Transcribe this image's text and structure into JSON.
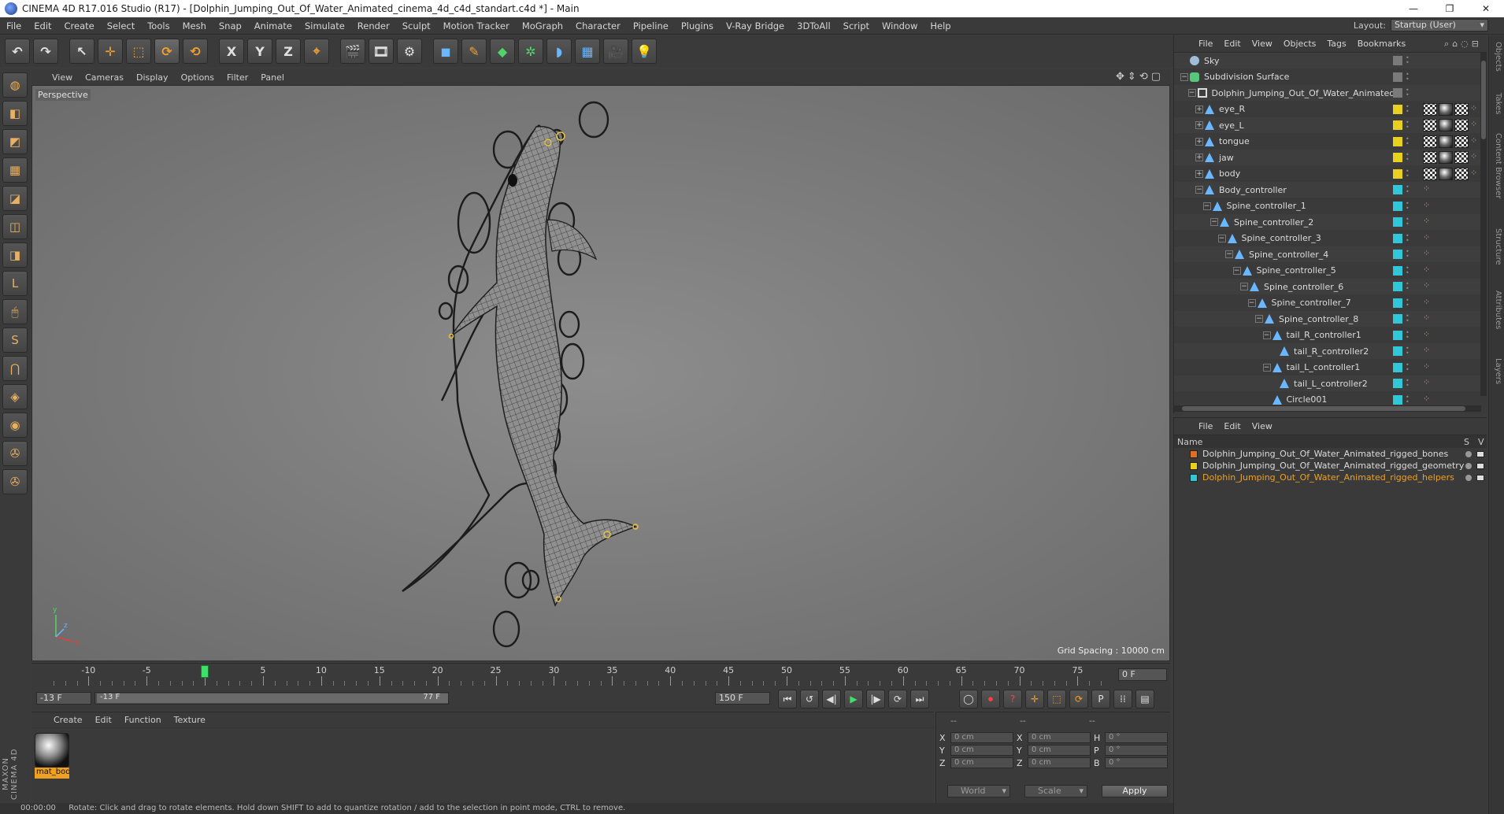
{
  "window": {
    "title": "CINEMA 4D R17.016 Studio (R17) - [Dolphin_Jumping_Out_Of_Water_Animated_cinema_4d_c4d_standart.c4d *] - Main",
    "controls": [
      "—",
      "❐",
      "✕"
    ]
  },
  "menubar": {
    "items": [
      "File",
      "Edit",
      "Create",
      "Select",
      "Tools",
      "Mesh",
      "Snap",
      "Animate",
      "Simulate",
      "Render",
      "Sculpt",
      "Motion Tracker",
      "MoGraph",
      "Character",
      "Pipeline",
      "Plugins",
      "V-Ray Bridge",
      "3DToAll",
      "Script",
      "Window",
      "Help"
    ],
    "layout_label": "Layout:",
    "layout_value": "Startup (User)"
  },
  "toolbar": {
    "undo": "↶",
    "redo": "↷",
    "live_select": "↖",
    "move": "✛",
    "scale": "⬚",
    "rotate": "⟳",
    "rotate2": "⟲",
    "axis_x": "X",
    "axis_y": "Y",
    "axis_z": "Z",
    "coord": "⌖",
    "render_view": "🎬",
    "render_pv": "🎞",
    "render_settings": "⚙",
    "cube": "◼",
    "pen": "✎",
    "subdiv": "◆",
    "array": "✲",
    "deformer": "◗",
    "floor": "▦",
    "camera": "🎥",
    "light": "💡"
  },
  "lefttools": {
    "items": [
      "◍",
      "◧",
      "◩",
      "▦",
      "◪",
      "◫",
      "◨",
      "L",
      "🖱",
      "S",
      "⋂",
      "◈",
      "◉",
      "✇",
      "✇"
    ],
    "brand": "MAXON CINEMA 4D"
  },
  "viewport": {
    "menu": [
      "View",
      "Cameras",
      "Display",
      "Options",
      "Filter",
      "Panel"
    ],
    "nav_icons": "✥⇕⟲▢",
    "label": "Perspective",
    "grid_spacing": "Grid Spacing : 10000 cm"
  },
  "timeline": {
    "ticks": [
      -10,
      -5,
      0,
      5,
      10,
      15,
      20,
      25,
      30,
      35,
      40,
      45,
      50,
      55,
      60,
      65,
      70,
      75
    ],
    "min": -13,
    "max": 77,
    "current_frame": 0,
    "frame_field": "0 F"
  },
  "playback": {
    "start_field": "-13 F",
    "range_start": "-13 F",
    "range_end": "77 F",
    "end_field": "150 F",
    "buttons": [
      "⏮",
      "↺",
      "◀|",
      "▶",
      "|▶",
      "⟳",
      "⏭"
    ],
    "key_buttons": [
      "◯",
      "⏺",
      "?",
      "✛",
      "⬚",
      "⟳",
      "P",
      "⁞⁞",
      "▤"
    ]
  },
  "materials": {
    "menu": [
      "Create",
      "Edit",
      "Function",
      "Texture"
    ],
    "items": [
      {
        "name": "mat_bod"
      }
    ]
  },
  "coordinates": {
    "head": [
      "--",
      "--",
      "--"
    ],
    "rows": [
      {
        "a1": "X",
        "v1": "0 cm",
        "a2": "X",
        "v2": "0 cm",
        "a3": "H",
        "v3": "0 °"
      },
      {
        "a1": "Y",
        "v1": "0 cm",
        "a2": "Y",
        "v2": "0 cm",
        "a3": "P",
        "v3": "0 °"
      },
      {
        "a1": "Z",
        "v1": "0 cm",
        "a2": "Z",
        "v2": "0 cm",
        "a3": "B",
        "v3": "0 °"
      }
    ],
    "space": "World",
    "mode": "Scale",
    "apply": "Apply"
  },
  "status": {
    "time": "00:00:00",
    "message": "Rotate: Click and drag to rotate elements. Hold down SHIFT to add to quantize rotation / add to the selection in point mode, CTRL to remove."
  },
  "object_manager": {
    "menu": [
      "File",
      "Edit",
      "View",
      "Objects",
      "Tags",
      "Bookmarks"
    ],
    "tools": "⌕⌂◌⊟",
    "objects": [
      {
        "name": "Sky",
        "icon": "sky",
        "depth": 0,
        "expander": "",
        "layer": "#7a7a7a",
        "tags": []
      },
      {
        "name": "Subdivision Surface",
        "icon": "subdiv",
        "depth": 0,
        "expander": "−",
        "layer": "#7a7a7a",
        "tags": []
      },
      {
        "name": "Dolphin_Jumping_Out_Of_Water_Animated",
        "icon": "null",
        "depth": 1,
        "expander": "−",
        "layer": "#7a7a7a",
        "tags": []
      },
      {
        "name": "eye_R",
        "icon": "bone",
        "depth": 2,
        "expander": "+",
        "layer": "#e8d020",
        "tags": [
          "check",
          "sphere",
          "check",
          "dots"
        ]
      },
      {
        "name": "eye_L",
        "icon": "bone",
        "depth": 2,
        "expander": "+",
        "layer": "#e8d020",
        "tags": [
          "check",
          "sphere",
          "check",
          "dots"
        ]
      },
      {
        "name": "tongue",
        "icon": "bone",
        "depth": 2,
        "expander": "+",
        "layer": "#e8d020",
        "tags": [
          "check",
          "sphere",
          "check",
          "dots"
        ]
      },
      {
        "name": "jaw",
        "icon": "bone",
        "depth": 2,
        "expander": "+",
        "layer": "#e8d020",
        "tags": [
          "check",
          "sphere",
          "check",
          "dots"
        ]
      },
      {
        "name": "body",
        "icon": "bone",
        "depth": 2,
        "expander": "+",
        "layer": "#e8d020",
        "tags": [
          "check",
          "sphere",
          "check",
          "dots"
        ]
      },
      {
        "name": "Body_controller",
        "icon": "bone",
        "depth": 2,
        "expander": "−",
        "layer": "#30c8d8",
        "tags": [
          "dots"
        ]
      },
      {
        "name": "Spine_controller_1",
        "icon": "bone",
        "depth": 3,
        "expander": "−",
        "layer": "#30c8d8",
        "tags": [
          "dots"
        ]
      },
      {
        "name": "Spine_controller_2",
        "icon": "bone",
        "depth": 4,
        "expander": "−",
        "layer": "#30c8d8",
        "tags": [
          "dots"
        ]
      },
      {
        "name": "Spine_controller_3",
        "icon": "bone",
        "depth": 5,
        "expander": "−",
        "layer": "#30c8d8",
        "tags": [
          "dots"
        ]
      },
      {
        "name": "Spine_controller_4",
        "icon": "bone",
        "depth": 6,
        "expander": "−",
        "layer": "#30c8d8",
        "tags": [
          "dots"
        ]
      },
      {
        "name": "Spine_controller_5",
        "icon": "bone",
        "depth": 7,
        "expander": "−",
        "layer": "#30c8d8",
        "tags": [
          "dots"
        ]
      },
      {
        "name": "Spine_controller_6",
        "icon": "bone",
        "depth": 8,
        "expander": "−",
        "layer": "#30c8d8",
        "tags": [
          "dots"
        ]
      },
      {
        "name": "Spine_controller_7",
        "icon": "bone",
        "depth": 9,
        "expander": "−",
        "layer": "#30c8d8",
        "tags": [
          "dots"
        ]
      },
      {
        "name": "Spine_controller_8",
        "icon": "bone",
        "depth": 10,
        "expander": "−",
        "layer": "#30c8d8",
        "tags": [
          "dots"
        ]
      },
      {
        "name": "tail_R_controller1",
        "icon": "bone",
        "depth": 11,
        "expander": "−",
        "layer": "#30c8d8",
        "tags": [
          "dots"
        ]
      },
      {
        "name": "tail_R_controller2",
        "icon": "bone",
        "depth": 12,
        "expander": "",
        "layer": "#30c8d8",
        "tags": [
          "dots"
        ]
      },
      {
        "name": "tail_L_controller1",
        "icon": "bone",
        "depth": 11,
        "expander": "−",
        "layer": "#30c8d8",
        "tags": [
          "dots"
        ]
      },
      {
        "name": "tail_L_controller2",
        "icon": "bone",
        "depth": 12,
        "expander": "",
        "layer": "#30c8d8",
        "tags": [
          "dots"
        ]
      },
      {
        "name": "Circle001",
        "icon": "bone",
        "depth": 11,
        "expander": "",
        "layer": "#30c8d8",
        "tags": [
          "dots"
        ]
      }
    ]
  },
  "layer_manager": {
    "menu": [
      "File",
      "Edit",
      "View"
    ],
    "header_name": "Name",
    "header_s": "S",
    "header_v": "V",
    "layers": [
      {
        "name": "Dolphin_Jumping_Out_Of_Water_Animated_rigged_bones",
        "color": "#e07020",
        "selected": false
      },
      {
        "name": "Dolphin_Jumping_Out_Of_Water_Animated_rigged_geometry",
        "color": "#e8d020",
        "selected": false
      },
      {
        "name": "Dolphin_Jumping_Out_Of_Water_Animated_rigged_helpers",
        "color": "#30c8d8",
        "selected": true
      }
    ]
  },
  "side_tabs": [
    "Objects",
    "Takes",
    "Content Browser",
    "Structure",
    "Attributes",
    "Layers"
  ]
}
